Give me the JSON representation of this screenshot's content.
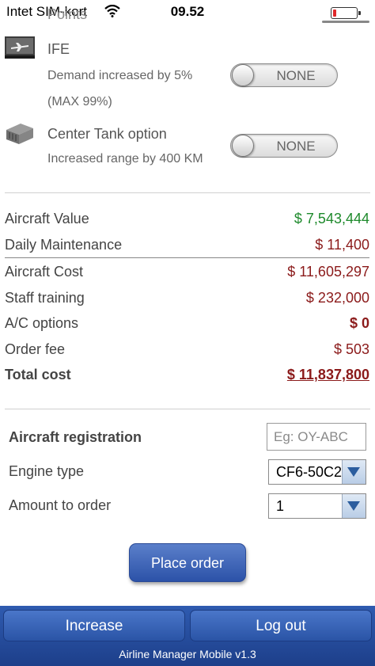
{
  "status_bar": {
    "carrier": "Intet SIM-kort",
    "time": "09.52"
  },
  "partial_header": "Points",
  "options": [
    {
      "icon": "plane-screen-icon",
      "name": "IFE",
      "description": "Demand increased by 5%",
      "note": "(MAX 99%)",
      "toggle": "NONE"
    },
    {
      "icon": "fuel-tank-icon",
      "name": "Center Tank option",
      "description": "Increased range by 400 KM",
      "toggle": "NONE"
    }
  ],
  "costs": {
    "aircraft_value": {
      "label": "Aircraft Value",
      "value": "$ 7,543,444"
    },
    "daily_maintenance": {
      "label": "Daily Maintenance",
      "value": "$ 11,400"
    },
    "aircraft_cost": {
      "label": "Aircraft Cost",
      "value": "$ 11,605,297"
    },
    "staff_training": {
      "label": "Staff training",
      "value": "$ 232,000"
    },
    "ac_options": {
      "label": "A/C options",
      "value": "$ 0"
    },
    "order_fee": {
      "label": "Order fee",
      "value": "$ 503"
    },
    "total": {
      "label": "Total cost",
      "value": "$ 11,837,800"
    }
  },
  "form": {
    "registration_label": "Aircraft registration",
    "registration_placeholder": "Eg: OY-ABC",
    "engine_label": "Engine type",
    "engine_value": "CF6-50C2",
    "amount_label": "Amount to order",
    "amount_value": "1"
  },
  "place_order_label": "Place order",
  "footer": {
    "increase_label": "Increase",
    "logout_label": "Log out",
    "credit": "Airline Manager Mobile v1.3"
  },
  "colors": {
    "positive": "#1e8a2c",
    "negative": "#8b1a1a",
    "button_blue": "#2c52a8"
  }
}
